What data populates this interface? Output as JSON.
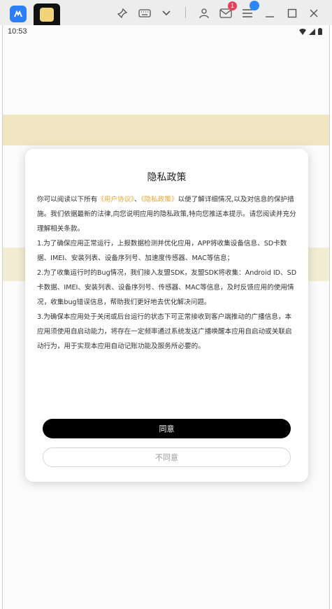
{
  "status_bar": {
    "time": "10:53"
  },
  "chrome": {
    "notification_count": "1"
  },
  "dialog": {
    "title": "隐私政策",
    "intro_before_links": "你可以阅读以下所有",
    "user_agreement_link": "《用户协议》",
    "link_separator": "、",
    "privacy_policy_link": "《隐私政策》",
    "intro_after_links": "以便了解详细情况,以及对信息的保护措施。我们依据最新的法律,向您说明应用的隐私政策,特向您推送本提示。请您阅读并充分理解相关条款。",
    "clauses": [
      "1.为了确保应用正常运行，上报数据检测并优化应用，APP将收集设备信息、SD卡数据、IMEI、安装列表、设备序列号、加速度传感器、MAC等信息；",
      "2.为了收集运行时的Bug情况，我们接入友盟SDK，友盟SDK将收集：Android ID、SD卡数据、IMEI、安装列表、设备序列号、传感器、MAC等信息，及时反馈应用的使用情况，收集bug错误信息，帮助我们更好地去优化解决问题。",
      "3.为确保本应用处于关闭或后台运行的状态下可正常接收到客户端推动的广播信息，本应用须使用自启动能力，将存在一定频率通过系统发送广播唤醒本应用自启动或关联启动行为，用于实现本应用自动记账功能及服务所必要的。"
    ],
    "agree_label": "同意",
    "disagree_label": "不同意"
  },
  "colors": {
    "link": "#e8a630",
    "agree_button": "#000000",
    "disagree_text": "#9a9a9a"
  }
}
